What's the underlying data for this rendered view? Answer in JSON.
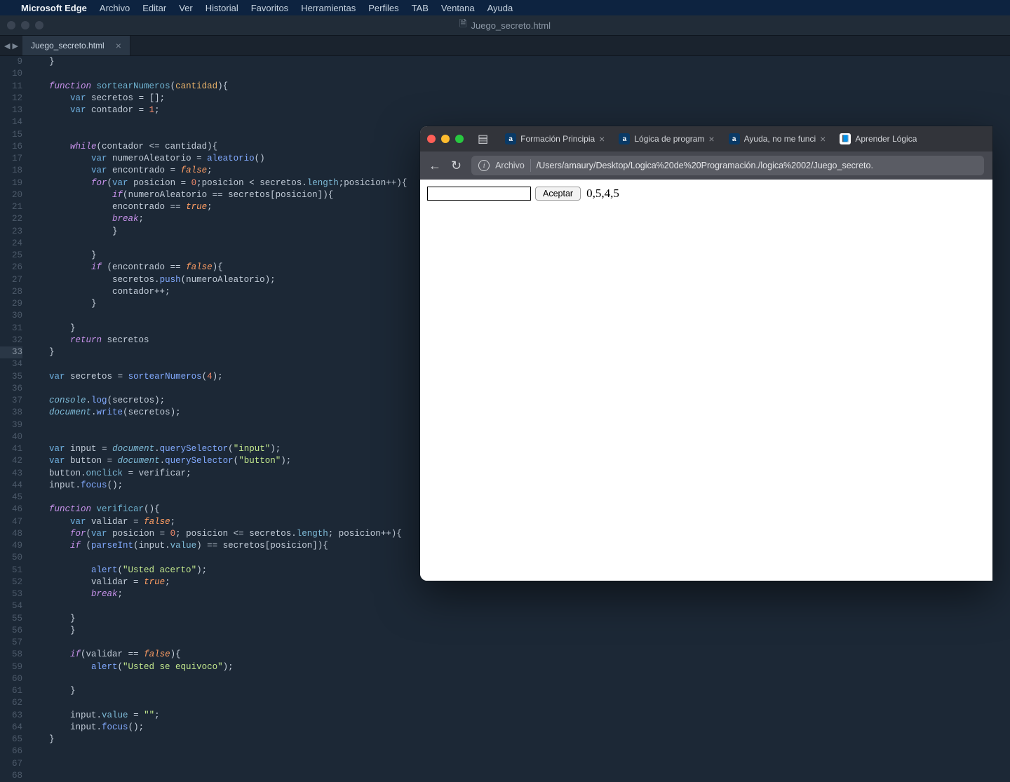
{
  "menubar": {
    "app": "Microsoft Edge",
    "items": [
      "Archivo",
      "Editar",
      "Ver",
      "Historial",
      "Favoritos",
      "Herramientas",
      "Perfiles",
      "TAB",
      "Ventana",
      "Ayuda"
    ]
  },
  "window": {
    "title": "Juego_secreto.html"
  },
  "editor": {
    "tab": "Juego_secreto.html",
    "startLine": 9,
    "highlightLine": 33,
    "lines": [
      [
        [
          "pn",
          "    }"
        ]
      ],
      [],
      [
        [
          "pn",
          "    "
        ],
        [
          "kw",
          "function"
        ],
        [
          "pn",
          " "
        ],
        [
          "fn",
          "sortearNumeros"
        ],
        [
          "pn",
          "("
        ],
        [
          "par",
          "cantidad"
        ],
        [
          "pn",
          ")"
        ],
        [
          "pn",
          "{"
        ]
      ],
      [
        [
          "pn",
          "        "
        ],
        [
          "st",
          "var"
        ],
        [
          "pn",
          " "
        ],
        [
          "id",
          "secretos"
        ],
        [
          "pn",
          " = [];"
        ]
      ],
      [
        [
          "pn",
          "        "
        ],
        [
          "st",
          "var"
        ],
        [
          "pn",
          " "
        ],
        [
          "id",
          "contador"
        ],
        [
          "pn",
          " = "
        ],
        [
          "nm",
          "1"
        ],
        [
          "pn",
          ";"
        ]
      ],
      [],
      [],
      [
        [
          "pn",
          "        "
        ],
        [
          "kw",
          "while"
        ],
        [
          "pn",
          "("
        ],
        [
          "id",
          "contador"
        ],
        [
          "pn",
          " "
        ],
        [
          "op",
          "<="
        ],
        [
          "pn",
          " "
        ],
        [
          "id",
          "cantidad"
        ],
        [
          "pn",
          ")"
        ],
        [
          "pn",
          "{"
        ]
      ],
      [
        [
          "pn",
          "            "
        ],
        [
          "st",
          "var"
        ],
        [
          "pn",
          " "
        ],
        [
          "id",
          "numeroAleatorio"
        ],
        [
          "pn",
          " = "
        ],
        [
          "call",
          "aleatorio"
        ],
        [
          "pn",
          "()"
        ]
      ],
      [
        [
          "pn",
          "            "
        ],
        [
          "st",
          "var"
        ],
        [
          "pn",
          " "
        ],
        [
          "id",
          "encontrado"
        ],
        [
          "pn",
          " = "
        ],
        [
          "bo",
          "false"
        ],
        [
          "pn",
          ";"
        ]
      ],
      [
        [
          "pn",
          "            "
        ],
        [
          "kw",
          "for"
        ],
        [
          "pn",
          "("
        ],
        [
          "st",
          "var"
        ],
        [
          "pn",
          " "
        ],
        [
          "id",
          "posicion"
        ],
        [
          "pn",
          " = "
        ],
        [
          "nm",
          "0"
        ],
        [
          "pn",
          ";"
        ],
        [
          "id",
          "posicion"
        ],
        [
          "pn",
          " "
        ],
        [
          "op",
          "<"
        ],
        [
          "pn",
          " "
        ],
        [
          "id",
          "secretos"
        ],
        [
          "pn",
          "."
        ],
        [
          "prop",
          "length"
        ],
        [
          "pn",
          ";"
        ],
        [
          "id",
          "posicion"
        ],
        [
          "op",
          "++"
        ],
        [
          "pn",
          ")"
        ],
        [
          "pn",
          "{"
        ]
      ],
      [
        [
          "pn",
          "                "
        ],
        [
          "kw",
          "if"
        ],
        [
          "pn",
          "("
        ],
        [
          "id",
          "numeroAleatorio"
        ],
        [
          "pn",
          " "
        ],
        [
          "op",
          "=="
        ],
        [
          "pn",
          " "
        ],
        [
          "id",
          "secretos"
        ],
        [
          "pn",
          "["
        ],
        [
          "id",
          "posicion"
        ],
        [
          "pn",
          "])"
        ],
        [
          "pn",
          "{"
        ]
      ],
      [
        [
          "pn",
          "                "
        ],
        [
          "id",
          "encontrado"
        ],
        [
          "pn",
          " "
        ],
        [
          "op",
          "=="
        ],
        [
          "pn",
          " "
        ],
        [
          "bo",
          "true"
        ],
        [
          "pn",
          ";"
        ]
      ],
      [
        [
          "pn",
          "                "
        ],
        [
          "kw",
          "break"
        ],
        [
          "pn",
          ";"
        ]
      ],
      [
        [
          "pn",
          "                }"
        ]
      ],
      [],
      [
        [
          "pn",
          "            }"
        ]
      ],
      [
        [
          "pn",
          "            "
        ],
        [
          "kw",
          "if"
        ],
        [
          "pn",
          " ("
        ],
        [
          "id",
          "encontrado"
        ],
        [
          "pn",
          " "
        ],
        [
          "op",
          "=="
        ],
        [
          "pn",
          " "
        ],
        [
          "bo",
          "false"
        ],
        [
          "pn",
          ")"
        ],
        [
          "pn",
          "{"
        ]
      ],
      [
        [
          "pn",
          "                "
        ],
        [
          "id",
          "secretos"
        ],
        [
          "pn",
          "."
        ],
        [
          "call",
          "push"
        ],
        [
          "pn",
          "("
        ],
        [
          "id",
          "numeroAleatorio"
        ],
        [
          "pn",
          ");"
        ]
      ],
      [
        [
          "pn",
          "                "
        ],
        [
          "id",
          "contador"
        ],
        [
          "op",
          "++"
        ],
        [
          "pn",
          ";"
        ]
      ],
      [
        [
          "pn",
          "            }"
        ]
      ],
      [],
      [
        [
          "pn",
          "        }"
        ]
      ],
      [
        [
          "pn",
          "        "
        ],
        [
          "kw",
          "return"
        ],
        [
          "pn",
          " "
        ],
        [
          "id",
          "secretos"
        ]
      ],
      [
        [
          "pn",
          "    }"
        ]
      ],
      [],
      [
        [
          "pn",
          "    "
        ],
        [
          "st",
          "var"
        ],
        [
          "pn",
          " "
        ],
        [
          "id",
          "secretos"
        ],
        [
          "pn",
          " "
        ],
        [
          "op",
          "="
        ],
        [
          "pn",
          " "
        ],
        [
          "call",
          "sortearNumeros"
        ],
        [
          "pn",
          "("
        ],
        [
          "nm",
          "4"
        ],
        [
          "pn",
          ");"
        ]
      ],
      [],
      [
        [
          "pn",
          "    "
        ],
        [
          "obj",
          "console"
        ],
        [
          "pn",
          "."
        ],
        [
          "call",
          "log"
        ],
        [
          "pn",
          "("
        ],
        [
          "id",
          "secretos"
        ],
        [
          "pn",
          ");"
        ]
      ],
      [
        [
          "pn",
          "    "
        ],
        [
          "obj",
          "document"
        ],
        [
          "pn",
          "."
        ],
        [
          "call",
          "write"
        ],
        [
          "pn",
          "("
        ],
        [
          "id",
          "secretos"
        ],
        [
          "pn",
          ");"
        ]
      ],
      [],
      [],
      [
        [
          "pn",
          "    "
        ],
        [
          "st",
          "var"
        ],
        [
          "pn",
          " "
        ],
        [
          "id",
          "input"
        ],
        [
          "pn",
          " "
        ],
        [
          "op",
          "="
        ],
        [
          "pn",
          " "
        ],
        [
          "obj",
          "document"
        ],
        [
          "pn",
          "."
        ],
        [
          "call",
          "querySelector"
        ],
        [
          "pn",
          "("
        ],
        [
          "str",
          "\"input\""
        ],
        [
          "pn",
          ");"
        ]
      ],
      [
        [
          "pn",
          "    "
        ],
        [
          "st",
          "var"
        ],
        [
          "pn",
          " "
        ],
        [
          "id",
          "button"
        ],
        [
          "pn",
          " "
        ],
        [
          "op",
          "="
        ],
        [
          "pn",
          " "
        ],
        [
          "obj",
          "document"
        ],
        [
          "pn",
          "."
        ],
        [
          "call",
          "querySelector"
        ],
        [
          "pn",
          "("
        ],
        [
          "str",
          "\"button\""
        ],
        [
          "pn",
          ");"
        ]
      ],
      [
        [
          "pn",
          "    "
        ],
        [
          "id",
          "button"
        ],
        [
          "pn",
          "."
        ],
        [
          "prop",
          "onclick"
        ],
        [
          "pn",
          " "
        ],
        [
          "op",
          "="
        ],
        [
          "pn",
          " "
        ],
        [
          "id",
          "verificar"
        ],
        [
          "pn",
          ";"
        ]
      ],
      [
        [
          "pn",
          "    "
        ],
        [
          "id",
          "input"
        ],
        [
          "pn",
          "."
        ],
        [
          "call",
          "focus"
        ],
        [
          "pn",
          "();"
        ]
      ],
      [],
      [
        [
          "pn",
          "    "
        ],
        [
          "kw",
          "function"
        ],
        [
          "pn",
          " "
        ],
        [
          "fn",
          "verificar"
        ],
        [
          "pn",
          "()"
        ],
        [
          "pn",
          "{"
        ]
      ],
      [
        [
          "pn",
          "        "
        ],
        [
          "st",
          "var"
        ],
        [
          "pn",
          " "
        ],
        [
          "id",
          "validar"
        ],
        [
          "pn",
          " "
        ],
        [
          "op",
          "="
        ],
        [
          "pn",
          " "
        ],
        [
          "bo",
          "false"
        ],
        [
          "pn",
          ";"
        ]
      ],
      [
        [
          "pn",
          "        "
        ],
        [
          "kw",
          "for"
        ],
        [
          "pn",
          "("
        ],
        [
          "st",
          "var"
        ],
        [
          "pn",
          " "
        ],
        [
          "id",
          "posicion"
        ],
        [
          "pn",
          " = "
        ],
        [
          "nm",
          "0"
        ],
        [
          "pn",
          "; "
        ],
        [
          "id",
          "posicion"
        ],
        [
          "pn",
          " "
        ],
        [
          "op",
          "<="
        ],
        [
          "pn",
          " "
        ],
        [
          "id",
          "secretos"
        ],
        [
          "pn",
          "."
        ],
        [
          "prop",
          "length"
        ],
        [
          "pn",
          "; "
        ],
        [
          "id",
          "posicion"
        ],
        [
          "op",
          "++"
        ],
        [
          "pn",
          ")"
        ],
        [
          "pn",
          "{"
        ]
      ],
      [
        [
          "pn",
          "        "
        ],
        [
          "kw",
          "if"
        ],
        [
          "pn",
          " ("
        ],
        [
          "call",
          "parseInt"
        ],
        [
          "pn",
          "("
        ],
        [
          "id",
          "input"
        ],
        [
          "pn",
          "."
        ],
        [
          "prop",
          "value"
        ],
        [
          "pn",
          ") "
        ],
        [
          "op",
          "=="
        ],
        [
          "pn",
          " "
        ],
        [
          "id",
          "secretos"
        ],
        [
          "pn",
          "["
        ],
        [
          "id",
          "posicion"
        ],
        [
          "pn",
          "])"
        ],
        [
          "pn",
          "{"
        ]
      ],
      [],
      [
        [
          "pn",
          "            "
        ],
        [
          "call",
          "alert"
        ],
        [
          "pn",
          "("
        ],
        [
          "str",
          "\"Usted acerto\""
        ],
        [
          "pn",
          ");"
        ]
      ],
      [
        [
          "pn",
          "            "
        ],
        [
          "id",
          "validar"
        ],
        [
          "pn",
          " "
        ],
        [
          "op",
          "="
        ],
        [
          "pn",
          " "
        ],
        [
          "bo",
          "true"
        ],
        [
          "pn",
          ";"
        ]
      ],
      [
        [
          "pn",
          "            "
        ],
        [
          "kw",
          "break"
        ],
        [
          "pn",
          ";"
        ]
      ],
      [],
      [
        [
          "pn",
          "        }"
        ]
      ],
      [
        [
          "pn",
          "        }"
        ]
      ],
      [],
      [
        [
          "pn",
          "        "
        ],
        [
          "kw",
          "if"
        ],
        [
          "pn",
          "("
        ],
        [
          "id",
          "validar"
        ],
        [
          "pn",
          " "
        ],
        [
          "op",
          "=="
        ],
        [
          "pn",
          " "
        ],
        [
          "bo",
          "false"
        ],
        [
          "pn",
          ")"
        ],
        [
          "pn",
          "{"
        ]
      ],
      [
        [
          "pn",
          "            "
        ],
        [
          "call",
          "alert"
        ],
        [
          "pn",
          "("
        ],
        [
          "str",
          "\"Usted se equivoco\""
        ],
        [
          "pn",
          ");"
        ]
      ],
      [],
      [
        [
          "pn",
          "        }"
        ]
      ],
      [],
      [
        [
          "pn",
          "        "
        ],
        [
          "id",
          "input"
        ],
        [
          "pn",
          "."
        ],
        [
          "prop",
          "value"
        ],
        [
          "pn",
          " "
        ],
        [
          "op",
          "="
        ],
        [
          "pn",
          " "
        ],
        [
          "str",
          "\"\""
        ],
        [
          "pn",
          ";"
        ]
      ],
      [
        [
          "pn",
          "        "
        ],
        [
          "id",
          "input"
        ],
        [
          "pn",
          "."
        ],
        [
          "call",
          "focus"
        ],
        [
          "pn",
          "();"
        ]
      ],
      [
        [
          "pn",
          "    }"
        ]
      ],
      [],
      [],
      []
    ]
  },
  "browser": {
    "tabs": [
      {
        "label": "Formación Principia",
        "favicon": "a"
      },
      {
        "label": "Lógica de program",
        "favicon": "a"
      },
      {
        "label": "Ayuda, no me funci",
        "favicon": "a"
      },
      {
        "label": "Aprender Lógica",
        "favicon": "book"
      }
    ],
    "address": {
      "scheme": "Archivo",
      "path": "/Users/amaury/Desktop/Logica%20de%20Programación./logica%2002/Juego_secreto."
    },
    "page": {
      "button": "Aceptar",
      "output": "0,5,4,5"
    }
  }
}
